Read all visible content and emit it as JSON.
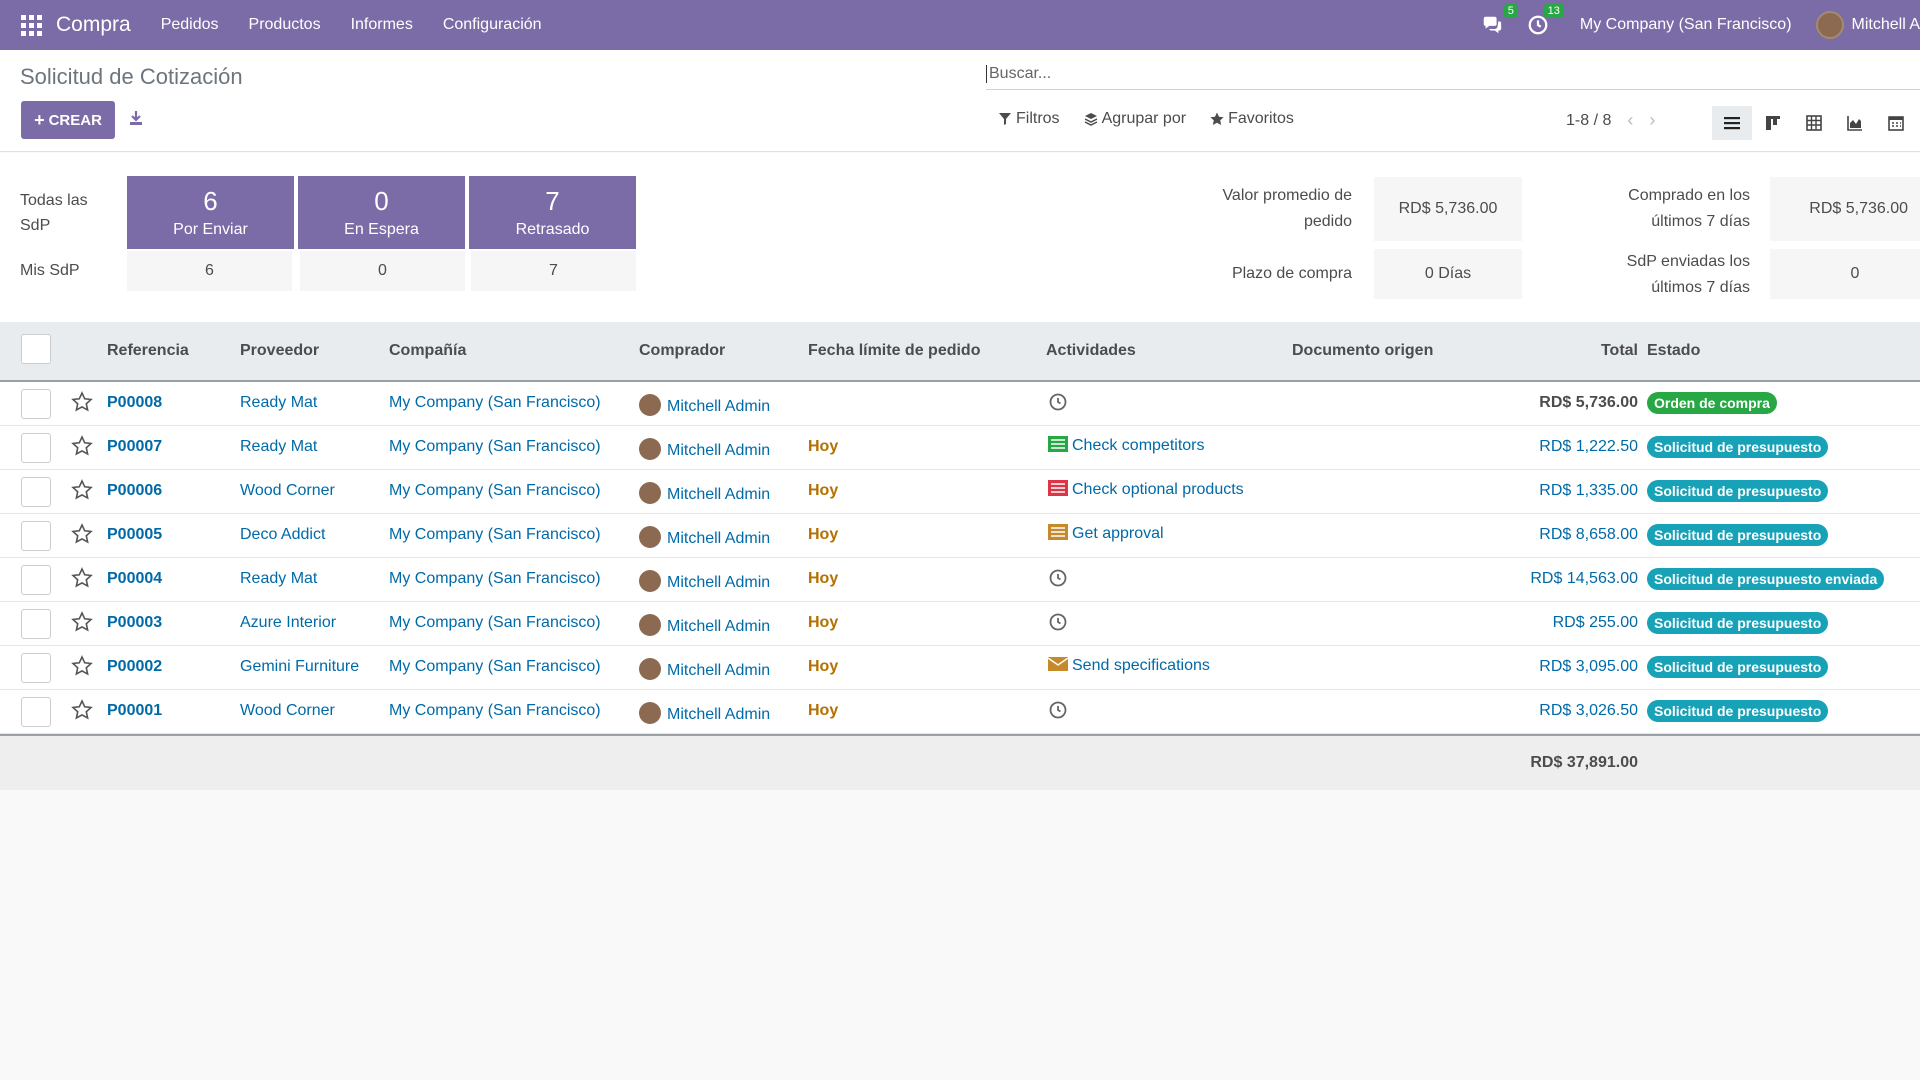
{
  "navbar": {
    "app_name": "Compra",
    "menu": [
      "Pedidos",
      "Productos",
      "Informes",
      "Configuración"
    ],
    "messages_count": "5",
    "activities_count": "13",
    "company": "My Company (San Francisco)",
    "user": "Mitchell A"
  },
  "control": {
    "title": "Solicitud de Cotización",
    "create_label": "CREAR",
    "search_placeholder": "Buscar...",
    "filters_label": "Filtros",
    "groupby_label": "Agrupar por",
    "favorites_label": "Favoritos",
    "pager": "1-8 / 8"
  },
  "dashboard": {
    "all_label": "Todas las SdP",
    "mine_label": "Mis SdP",
    "tiles": [
      {
        "num": "6",
        "label": "Por Enviar",
        "mine": "6"
      },
      {
        "num": "0",
        "label": "En Espera",
        "mine": "0"
      },
      {
        "num": "7",
        "label": "Retrasado",
        "mine": "7"
      }
    ],
    "avg_label": "Valor promedio de pedido",
    "avg_value": "RD$ 5,736.00",
    "lead_label": "Plazo de compra",
    "lead_value": "0 Días",
    "purchased_label": "Comprado en los últimos 7 días",
    "purchased_value": "RD$ 5,736.00",
    "sent_label": "SdP enviadas los últimos 7 días",
    "sent_value": "0"
  },
  "table": {
    "headers": {
      "ref": "Referencia",
      "vendor": "Proveedor",
      "company": "Compañía",
      "buyer": "Comprador",
      "deadline": "Fecha límite de pedido",
      "activities": "Actividades",
      "origin": "Documento origen",
      "total": "Total",
      "state": "Estado"
    },
    "rows": [
      {
        "ref": "P00008",
        "vendor": "Ready Mat",
        "company": "My Company (San Francisco)",
        "buyer": "Mitchell Admin",
        "deadline": "",
        "activity": "",
        "activity_icon": "clock-icon",
        "total": "RD$ 5,736.00",
        "state": "Orden de compra",
        "state_color": "green"
      },
      {
        "ref": "P00007",
        "vendor": "Ready Mat",
        "company": "My Company (San Francisco)",
        "buyer": "Mitchell Admin",
        "deadline": "Hoy",
        "activity": "Check competitors",
        "activity_icon": "task-green-icon",
        "total": "RD$ 1,222.50",
        "state": "Solicitud de presupuesto",
        "state_color": "blue"
      },
      {
        "ref": "P00006",
        "vendor": "Wood Corner",
        "company": "My Company (San Francisco)",
        "buyer": "Mitchell Admin",
        "deadline": "Hoy",
        "activity": "Check optional products",
        "activity_icon": "task-red-icon",
        "total": "RD$ 1,335.00",
        "state": "Solicitud de presupuesto",
        "state_color": "blue"
      },
      {
        "ref": "P00005",
        "vendor": "Deco Addict",
        "company": "My Company (San Francisco)",
        "buyer": "Mitchell Admin",
        "deadline": "Hoy",
        "activity": "Get approval",
        "activity_icon": "task-orange-icon",
        "total": "RD$ 8,658.00",
        "state": "Solicitud de presupuesto",
        "state_color": "blue"
      },
      {
        "ref": "P00004",
        "vendor": "Ready Mat",
        "company": "My Company (San Francisco)",
        "buyer": "Mitchell Admin",
        "deadline": "Hoy",
        "activity": "",
        "activity_icon": "clock-icon",
        "total": "RD$ 14,563.00",
        "state": "Solicitud de presupuesto enviada",
        "state_color": "blue"
      },
      {
        "ref": "P00003",
        "vendor": "Azure Interior",
        "company": "My Company (San Francisco)",
        "buyer": "Mitchell Admin",
        "deadline": "Hoy",
        "activity": "",
        "activity_icon": "clock-icon",
        "total": "RD$ 255.00",
        "state": "Solicitud de presupuesto",
        "state_color": "blue"
      },
      {
        "ref": "P00002",
        "vendor": "Gemini Furniture",
        "company": "My Company (San Francisco)",
        "buyer": "Mitchell Admin",
        "deadline": "Hoy",
        "activity": "Send specifications",
        "activity_icon": "envelope-icon",
        "total": "RD$ 3,095.00",
        "state": "Solicitud de presupuesto",
        "state_color": "blue"
      },
      {
        "ref": "P00001",
        "vendor": "Wood Corner",
        "company": "My Company (San Francisco)",
        "buyer": "Mitchell Admin",
        "deadline": "Hoy",
        "activity": "",
        "activity_icon": "clock-icon",
        "total": "RD$ 3,026.50",
        "state": "Solicitud de presupuesto",
        "state_color": "blue"
      }
    ],
    "grand_total": "RD$ 37,891.00"
  }
}
